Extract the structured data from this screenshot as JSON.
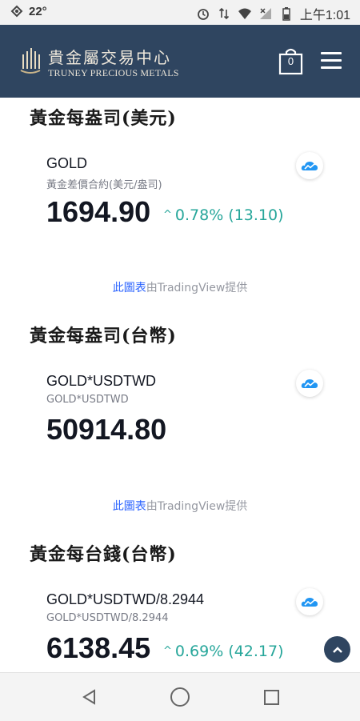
{
  "status_bar": {
    "temperature": "22°",
    "time": "上午1:01"
  },
  "header": {
    "logo_zh": "貴金屬交易中心",
    "logo_en": "TRUNEY PRECIOUS METALS",
    "cart_count": "0"
  },
  "sections": [
    {
      "title": "黃金每盎司(美元)",
      "symbol": "GOLD",
      "description": "黃金差價合約(美元/盎司)",
      "price": "1694.90",
      "change": "0.78% (13.10)"
    },
    {
      "title": "黃金每盎司(台幣)",
      "symbol": "GOLD*USDTWD",
      "description": "GOLD*USDTWD",
      "price": "50914.80",
      "change": ""
    },
    {
      "title": "黃金每台錢(台幣)",
      "symbol": "GOLD*USDTWD/8.2944",
      "description": "GOLD*USDTWD/8.2944",
      "price": "6138.45",
      "change": "0.69% (42.17)"
    }
  ],
  "credit": {
    "link_text": "此圖表",
    "mid_text": "由",
    "brand": "TradingView",
    "suffix": "提供"
  },
  "colors": {
    "header_bg": "#2f4560",
    "positive": "#26a69a",
    "link": "#2962ff"
  }
}
